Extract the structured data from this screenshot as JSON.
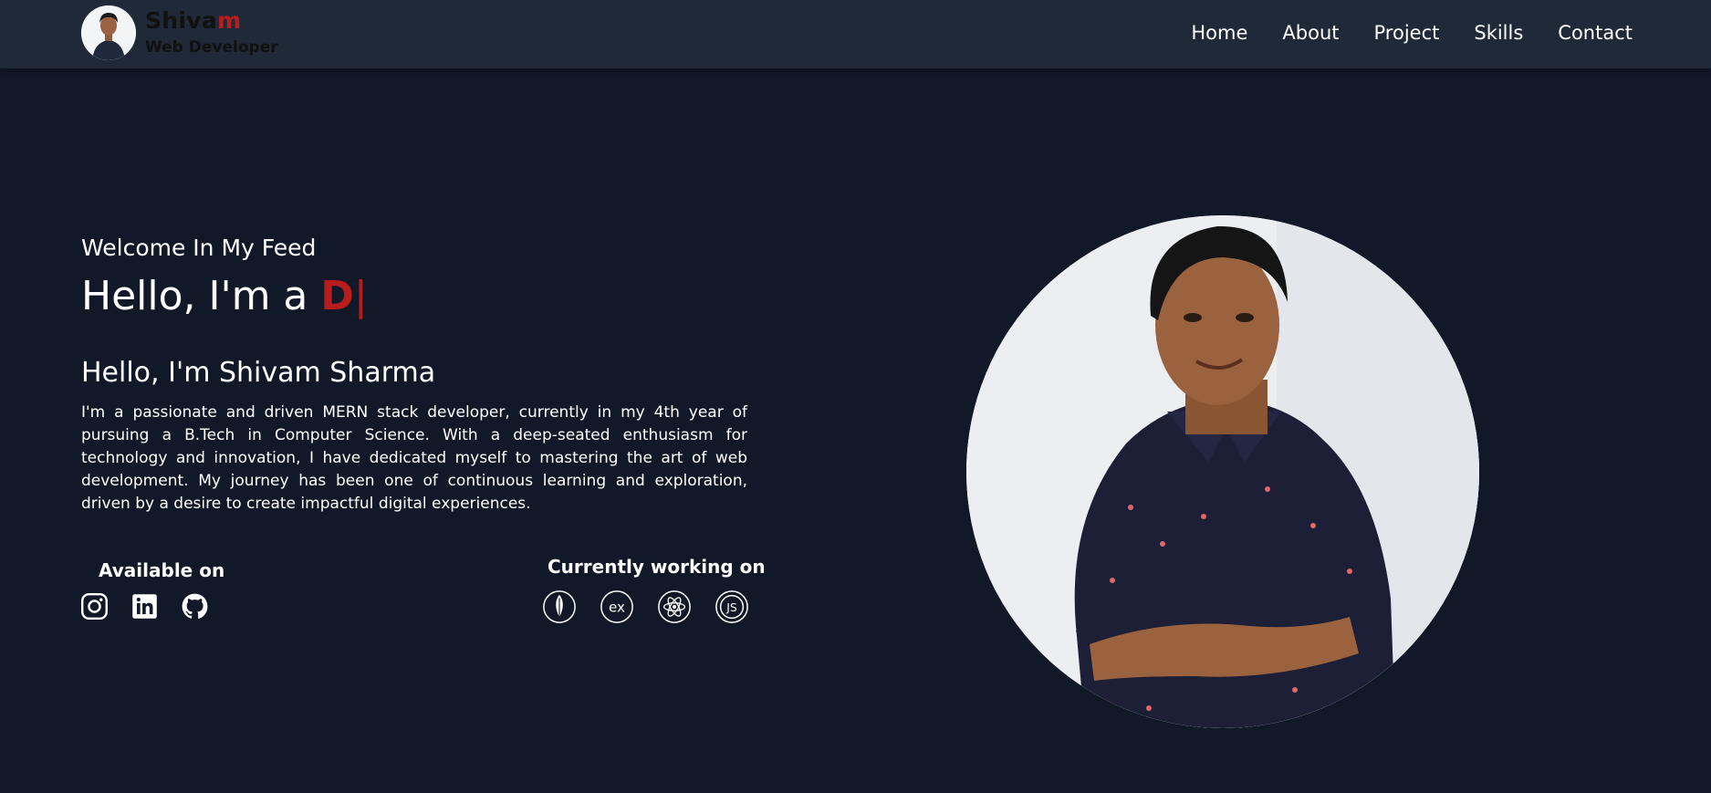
{
  "header": {
    "brand_name_main": "Shiva",
    "brand_name_accent": "m",
    "brand_role": "Web Developer",
    "nav": [
      {
        "label": "Home"
      },
      {
        "label": "About"
      },
      {
        "label": "Project"
      },
      {
        "label": "Skills"
      },
      {
        "label": "Contact"
      }
    ]
  },
  "hero": {
    "welcome": "Welcome In My Feed",
    "greeting_prefix": "Hello, I'm a",
    "typed_text": "D",
    "cursor": "|",
    "intro_title": "Hello, I'm Shivam Sharma",
    "paragraph": "I'm a passionate and driven MERN stack developer, currently in my 4th year of pursuing a B.Tech in Computer Science. With a deep-seated enthusiasm for technology and innovation, I have dedicated myself to mastering the art of web development. My journey has been one of continuous learning and exploration, driven by a desire to create impactful digital experiences."
  },
  "available": {
    "label": "Available on",
    "icons": [
      "instagram-icon",
      "linkedin-icon",
      "github-icon"
    ]
  },
  "working": {
    "label": "Currently working on",
    "icons": [
      "mongodb-icon",
      "express-icon",
      "react-icon",
      "nodejs-icon"
    ]
  },
  "colors": {
    "background": "#111827",
    "navbar": "#1f2937",
    "accent": "#b91c1c",
    "text": "#ffffff"
  }
}
